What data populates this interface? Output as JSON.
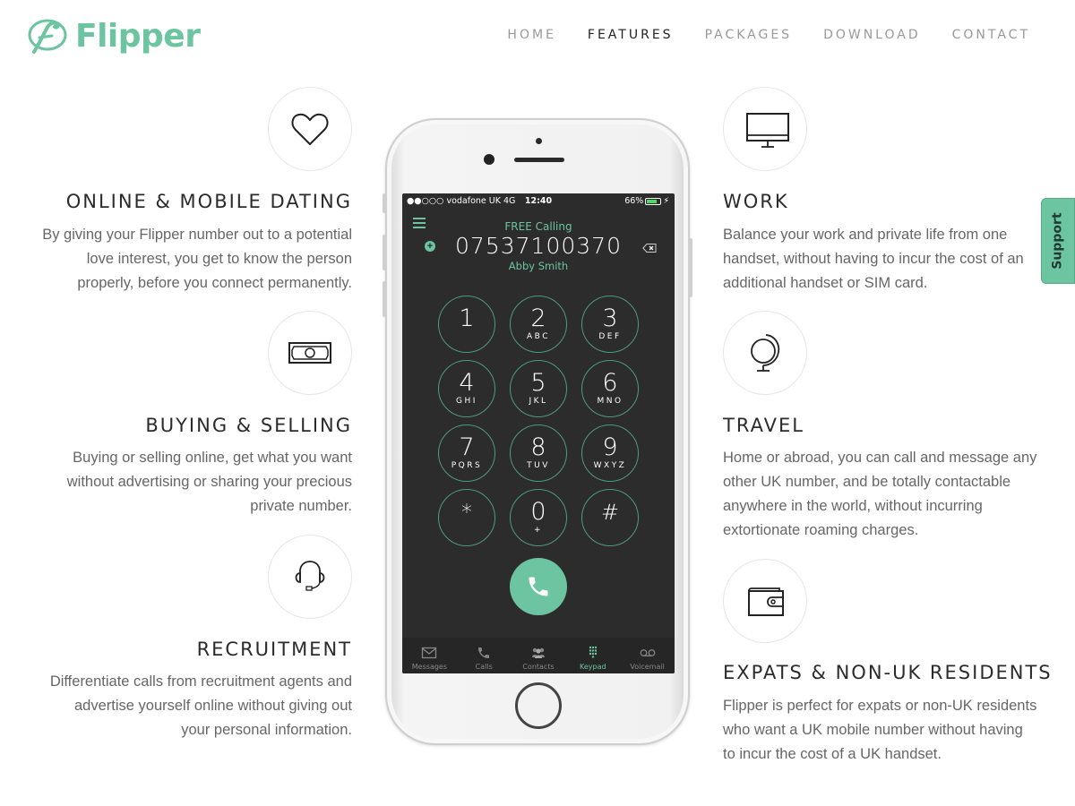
{
  "brand": {
    "name": "Flipper",
    "accent_color": "#6cc4a0"
  },
  "nav": {
    "items": [
      {
        "label": "HOME",
        "active": false
      },
      {
        "label": "FEATURES",
        "active": true
      },
      {
        "label": "PACKAGES",
        "active": false
      },
      {
        "label": "DOWNLOAD",
        "active": false
      },
      {
        "label": "CONTACT",
        "active": false
      }
    ]
  },
  "features": {
    "left": [
      {
        "icon": "heart-icon",
        "title": "ONLINE & MOBILE DATING",
        "lines": [
          "By giving your Flipper number out to a potential",
          "love interest, you get to know the person",
          "properly, before you connect permanently."
        ]
      },
      {
        "icon": "banknote-icon",
        "title": "BUYING & SELLING",
        "lines": [
          "Buying or selling online, get what you want",
          "without advertising or sharing your precious",
          "private number."
        ]
      },
      {
        "icon": "headset-icon",
        "title": "RECRUITMENT",
        "lines": [
          "Differentiate calls from recruitment agents and",
          "advertise yourself online without giving out",
          "your personal information."
        ]
      }
    ],
    "right": [
      {
        "icon": "monitor-icon",
        "title": "WORK",
        "lines": [
          "Balance your work and private life from one",
          "handset, without having to incur the cost of an",
          "additional handset or SIM card."
        ]
      },
      {
        "icon": "globe-icon",
        "title": "TRAVEL",
        "lines": [
          "Home or abroad, you can call and message any",
          "other UK number, and be totally contactable",
          "anywhere in the world, without incurring",
          "extortionate roaming charges."
        ]
      },
      {
        "icon": "wallet-icon",
        "title": "EXPATS & NON-UK RESIDENTS",
        "lines": [
          "Flipper is perfect for expats or non-UK residents",
          "who want a UK mobile number without having",
          "to incur the cost of a UK handset."
        ]
      }
    ]
  },
  "support_tab": {
    "label": "Support"
  },
  "phone": {
    "status": {
      "carrier": "●●○○○ vodafone UK  4G",
      "time": "12:40",
      "battery": "66%",
      "battery_level": 0.66
    },
    "header_label": "FREE Calling",
    "dialed_number": "07537100370",
    "contact_name": "Abby Smith",
    "keys": [
      {
        "digit": "1",
        "letters": ""
      },
      {
        "digit": "2",
        "letters": "ABC"
      },
      {
        "digit": "3",
        "letters": "DEF"
      },
      {
        "digit": "4",
        "letters": "GHI"
      },
      {
        "digit": "5",
        "letters": "JKL"
      },
      {
        "digit": "6",
        "letters": "MNO"
      },
      {
        "digit": "7",
        "letters": "PQRS"
      },
      {
        "digit": "8",
        "letters": "TUV"
      },
      {
        "digit": "9",
        "letters": "WXYZ"
      },
      {
        "digit": "*",
        "letters": ""
      },
      {
        "digit": "0",
        "letters": "+"
      },
      {
        "digit": "#",
        "letters": ""
      }
    ],
    "tabs": [
      {
        "label": "Messages",
        "icon": "envelope-icon",
        "active": false
      },
      {
        "label": "Calls",
        "icon": "phone-icon",
        "active": false
      },
      {
        "label": "Contacts",
        "icon": "contacts-icon",
        "active": false
      },
      {
        "label": "Keypad",
        "icon": "keypad-icon",
        "active": true
      },
      {
        "label": "Voicemail",
        "icon": "voicemail-icon",
        "active": false
      }
    ]
  }
}
